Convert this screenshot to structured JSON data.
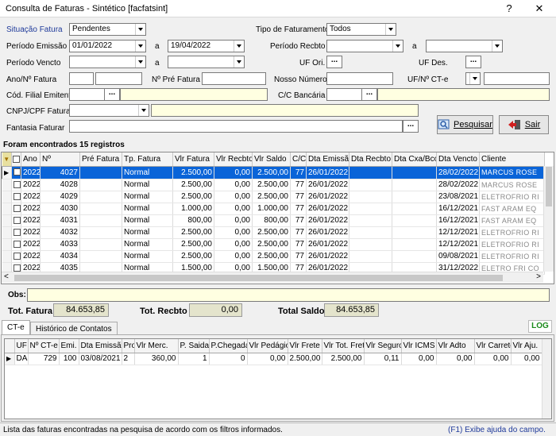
{
  "window": {
    "title": "Consulta de Faturas - Sintético [facfatsint]",
    "help": "?",
    "close": "✕"
  },
  "filters": {
    "situacao_label": "Situação Fatura",
    "situacao_value": "Pendentes",
    "tipo_fat_label": "Tipo de Faturamento",
    "tipo_fat_value": "Todos",
    "emissao_label": "Período Emissão",
    "emissao_from": "01/01/2022",
    "emissao_to": "19/04/2022",
    "a": "a",
    "recbto_label": "Período Recbto",
    "vencto_label": "Período Vencto",
    "uf_ori_label": "UF Ori.",
    "uf_des_label": "UF Des.",
    "ano_label": "Ano/Nº  Fatura",
    "pre_fatura_label": "Nº Pré Fatura",
    "nosso_numero_label": "Nosso Número",
    "uf_cte_label": "UF/Nº CT-e",
    "filial_label": "Cód. Filial Emitente",
    "cc_bancaria_label": "C/C Bancária",
    "cnpj_label": "CNPJ/CPF Faturar",
    "fantasia_label": "Fantasia Faturar",
    "dots": "...",
    "pesquisar": "Pesquisar",
    "sair": "Sair"
  },
  "result_label": "Foram encontrados 15 registros",
  "faturas": {
    "columns": [
      "",
      "Ano",
      "Nº",
      "Pré Fatura",
      "Tp. Fatura",
      "Vlr Fatura",
      "Vlr Recbto",
      "Vlr Saldo",
      "C/C",
      "Dta Emissão",
      "Dta Recbto",
      "Dta Cxa/Bco",
      "Dta Vencto",
      "Cliente"
    ],
    "rows": [
      [
        "2022",
        "4027",
        "",
        "Normal",
        "2.500,00",
        "0,00",
        "2.500,00",
        "77",
        "26/01/2022",
        "",
        "",
        "28/02/2022",
        "MARCUS ROSE"
      ],
      [
        "2022",
        "4028",
        "",
        "Normal",
        "2.500,00",
        "0,00",
        "2.500,00",
        "77",
        "26/01/2022",
        "",
        "",
        "28/02/2022",
        "MARCUS ROSE"
      ],
      [
        "2022",
        "4029",
        "",
        "Normal",
        "2.500,00",
        "0,00",
        "2.500,00",
        "77",
        "26/01/2022",
        "",
        "",
        "23/08/2021",
        "ELETROFRIO RI"
      ],
      [
        "2022",
        "4030",
        "",
        "Normal",
        "1.000,00",
        "0,00",
        "1.000,00",
        "77",
        "26/01/2022",
        "",
        "",
        "16/12/2021",
        "FAST ARAM EQ"
      ],
      [
        "2022",
        "4031",
        "",
        "Normal",
        "800,00",
        "0,00",
        "800,00",
        "77",
        "26/01/2022",
        "",
        "",
        "16/12/2021",
        "FAST ARAM EQ"
      ],
      [
        "2022",
        "4032",
        "",
        "Normal",
        "2.500,00",
        "0,00",
        "2.500,00",
        "77",
        "26/01/2022",
        "",
        "",
        "12/12/2021",
        "ELETROFRIO RI"
      ],
      [
        "2022",
        "4033",
        "",
        "Normal",
        "2.500,00",
        "0,00",
        "2.500,00",
        "77",
        "26/01/2022",
        "",
        "",
        "12/12/2021",
        "ELETROFRIO RI"
      ],
      [
        "2022",
        "4034",
        "",
        "Normal",
        "2.500,00",
        "0,00",
        "2.500,00",
        "77",
        "26/01/2022",
        "",
        "",
        "09/08/2021",
        "ELETROFRIO RI"
      ],
      [
        "2022",
        "4035",
        "",
        "Normal",
        "1.500,00",
        "0,00",
        "1.500,00",
        "77",
        "26/01/2022",
        "",
        "",
        "31/12/2022",
        "ELETRO FRI CO"
      ]
    ]
  },
  "obs_label": "Obs:",
  "totals": {
    "fatura_label": "Tot. Fatura",
    "fatura_value": "84.653,85",
    "recbto_label": "Tot. Recbto",
    "recbto_value": "0,00",
    "saldo_label": "Total Saldo",
    "saldo_value": "84.653,85"
  },
  "tabs": {
    "cte": "CT-e",
    "historico": "Histórico de Contatos",
    "log": "LOG"
  },
  "cte": {
    "columns": [
      "UF",
      "Nº CT-e",
      "Emi.",
      "Dta Emissão",
      "Pro",
      "Vlr Merc.",
      "P. Saida",
      "P.Chegada",
      "Vlr Pedágio",
      "Vlr Frete",
      "Vlr Tot. Frete",
      "Vlr Seguro",
      "Vlr ICMS",
      "Vlr Adto",
      "Vlr Carreto",
      "Vlr Aju."
    ],
    "rows": [
      [
        "DA",
        "729",
        "100",
        "03/08/2021",
        "2",
        "360,00",
        "1",
        "0",
        "0,00",
        "2.500,00",
        "2.500,00",
        "0,11",
        "0,00",
        "0,00",
        "0,00",
        "0,00"
      ]
    ]
  },
  "status": {
    "left": "Lista das faturas encontradas na pesquisa de acordo com os filtros informados.",
    "right": "(F1) Exibe ajuda do campo."
  },
  "colors": {
    "selection": "#0a64d8",
    "yellow_input": "#ffffe1",
    "log_green": "#1a8a1a"
  }
}
